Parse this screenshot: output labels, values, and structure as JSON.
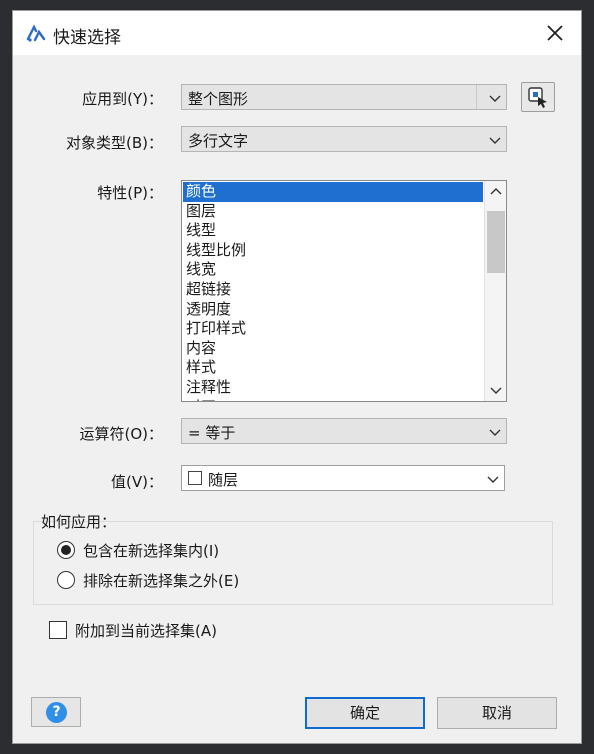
{
  "window": {
    "title": "快速选择",
    "icon": "app-logo-icon",
    "close_icon": "close-icon"
  },
  "apply_to": {
    "label": "应用到(Y)：",
    "value": "整个图形",
    "pick_icon": "select-objects-icon"
  },
  "object_type": {
    "label": "对象类型(B)：",
    "value": "多行文字"
  },
  "properties": {
    "label": "特性(P)：",
    "items": [
      "颜色",
      "图层",
      "线型",
      "线型比例",
      "线宽",
      "超链接",
      "透明度",
      "打印样式",
      "内容",
      "样式",
      "注释性",
      "对正"
    ],
    "selected": "颜色"
  },
  "operator": {
    "label": "运算符(O)：",
    "value": "=  等于"
  },
  "value_field": {
    "label": "值(V)：",
    "value": "随层",
    "swatch_color": "#ffffff"
  },
  "how_to_apply": {
    "title": "如何应用：",
    "include_label": "包含在新选择集内(I)",
    "exclude_label": "排除在新选择集之外(E)",
    "selected": "include"
  },
  "append": {
    "label": "附加到当前选择集(A)",
    "checked": false
  },
  "footer": {
    "help_text": "?",
    "ok_label": "确定",
    "cancel_label": "取消"
  },
  "colors": {
    "accent": "#1e6fd0",
    "help": "#2f8ee5"
  }
}
